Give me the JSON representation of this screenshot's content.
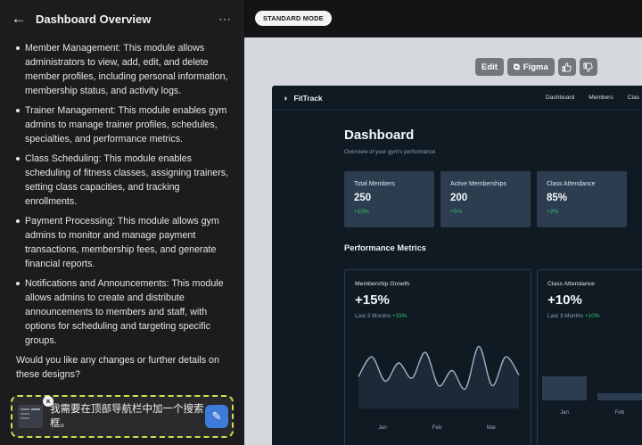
{
  "header": {
    "title": "Dashboard Overview"
  },
  "chat": {
    "bullets": [
      "Member Management: This module allows administrators to view, add, edit, and delete member profiles, including personal information, membership status, and activity logs.",
      "Trainer Management: This module enables gym admins to manage trainer profiles, schedules, specialties, and performance metrics.",
      "Class Scheduling: This module enables scheduling of fitness classes, assigning trainers, setting class capacities, and tracking enrollments.",
      "Payment Processing: This module allows gym admins to monitor and manage payment transactions, membership fees, and generate financial reports.",
      "Notifications and Announcements: This module allows admins to create and distribute announcements to members and staff, with options for scheduling and targeting specific groups."
    ],
    "closing": "Would you like any changes or further details on these designs?"
  },
  "composer": {
    "text": "我需要在顶部导航栏中加一个搜索框。"
  },
  "mode": {
    "label": "STANDARD MODE"
  },
  "toolbar": {
    "edit": "Edit",
    "figma": "Figma"
  },
  "preview": {
    "brand": "FitTrack",
    "nav": [
      "Dashboard",
      "Members",
      "Clas"
    ],
    "title": "Dashboard",
    "subtitle": "Overview of your gym's performance",
    "stats": [
      {
        "label": "Total Members",
        "value": "250",
        "change": "+10%"
      },
      {
        "label": "Active Memberships",
        "value": "200",
        "change": "+5%"
      },
      {
        "label": "Class Attendance",
        "value": "85%",
        "change": "+2%"
      }
    ],
    "section_title": "Performance Metrics",
    "growth_card": {
      "label": "Membership Growth",
      "value": "+15%",
      "sub": "Last 3 Months",
      "sub_change": "+15%"
    },
    "attendance_card": {
      "label": "Class Attendance",
      "value": "+10%",
      "sub": "Last 3 Months",
      "sub_change": "+10%"
    }
  },
  "colors": {
    "accent_green": "#35c46b",
    "composer_border": "#c8e24a",
    "send_blue": "#3e7bd8"
  },
  "chart_data": [
    {
      "type": "line",
      "x": [
        "Jan",
        "Feb",
        "Mar"
      ],
      "xlabel": "",
      "ylabel": "",
      "series": [
        {
          "values": [
            42,
            68,
            36,
            60,
            40,
            74,
            30,
            50,
            26,
            82,
            30,
            68,
            44
          ]
        }
      ],
      "ylim": [
        0,
        100
      ],
      "grid": false
    },
    {
      "type": "bar",
      "categories": [
        "Jan",
        "Feb"
      ],
      "values": [
        60,
        18
      ],
      "ylim": [
        0,
        100
      ],
      "grid": false
    }
  ]
}
